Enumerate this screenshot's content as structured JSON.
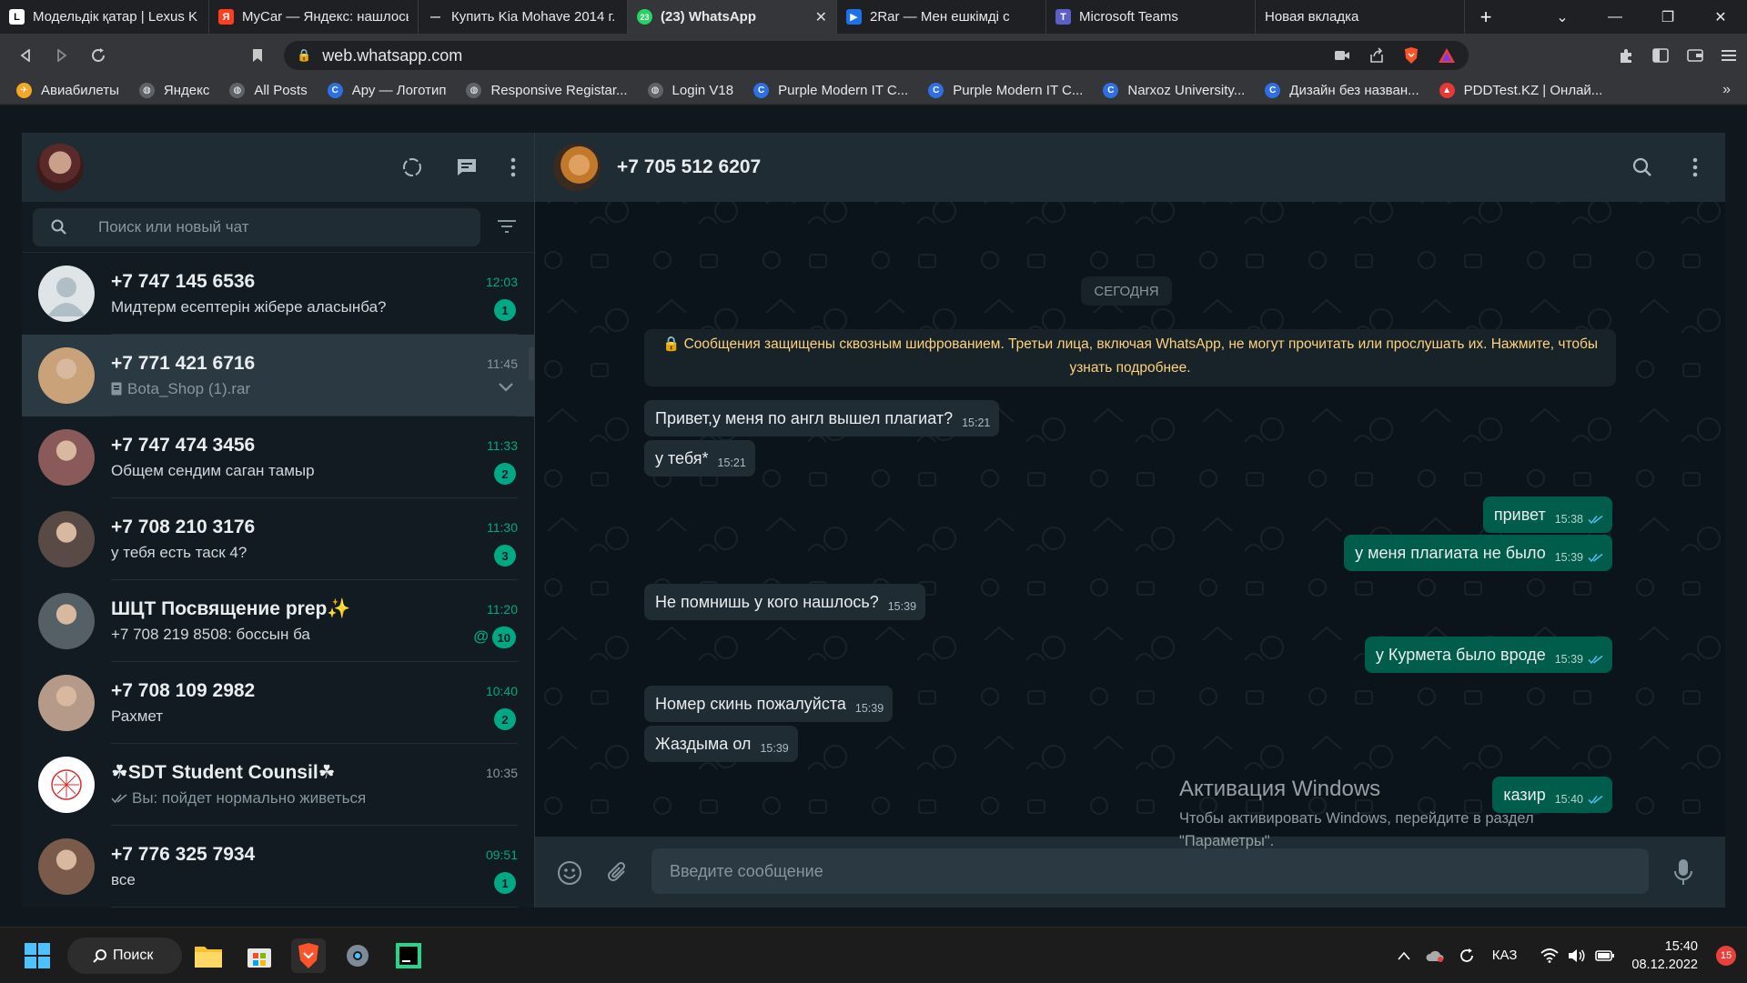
{
  "browser": {
    "tabs": [
      {
        "title": "Модельдік қатар | Lexus K",
        "icon_color": "#ffffff",
        "icon_text": "L",
        "icon_text_color": "#000000"
      },
      {
        "title": "MyCar — Яндекс: нашлось",
        "icon_color": "#fc3f1d",
        "icon_text": "Я",
        "icon_text_color": "#ffffff"
      },
      {
        "title": "Купить Kia Mohave 2014 г.",
        "icon_color": "#1f2023",
        "icon_text": "—",
        "icon_text_color": "#ffffff"
      },
      {
        "title": "(23) WhatsApp",
        "icon_color": "#25d366",
        "icon_text": "23",
        "icon_text_color": "#ffffff"
      },
      {
        "title": "2Rar — Мен ешкімді с",
        "icon_color": "#1a73e8",
        "icon_text": "▶",
        "icon_text_color": "#ffffff"
      },
      {
        "title": "Microsoft Teams",
        "icon_color": "#5b5fc7",
        "icon_text": "T",
        "icon_text_color": "#ffffff"
      },
      {
        "title": "Новая вкладка",
        "icon_color": "",
        "icon_text": "",
        "icon_text_color": ""
      }
    ],
    "url": "web.whatsapp.com",
    "bookmarks": [
      {
        "label": "Авиабилеты",
        "color": "#f5a623",
        "glyph": "✈"
      },
      {
        "label": "Яндекс",
        "color": "#5f6368",
        "glyph": "◍"
      },
      {
        "label": "All Posts",
        "color": "#5f6368",
        "glyph": "◍"
      },
      {
        "label": "Ару — Логотип",
        "color": "#2f6fe4",
        "glyph": "C"
      },
      {
        "label": "Responsive Registar...",
        "color": "#5f6368",
        "glyph": "◍"
      },
      {
        "label": "Login V18",
        "color": "#5f6368",
        "glyph": "◍"
      },
      {
        "label": "Purple Modern IT C...",
        "color": "#2f6fe4",
        "glyph": "C"
      },
      {
        "label": "Purple Modern IT C...",
        "color": "#2f6fe4",
        "glyph": "C"
      },
      {
        "label": "Narxoz University...",
        "color": "#2f6fe4",
        "glyph": "C"
      },
      {
        "label": "Дизайн без назван...",
        "color": "#2f6fe4",
        "glyph": "C"
      },
      {
        "label": "PDDTest.KZ | Онлай...",
        "color": "#e53935",
        "glyph": "▲"
      }
    ],
    "more": "»"
  },
  "sidebar": {
    "search_placeholder": "Поиск или новый чат",
    "chats": [
      {
        "name": "+7 747 145 6536",
        "message": "Мидтерм есептерін жібере аласынба?",
        "time": "12:03",
        "unread": "1",
        "time_green": true,
        "avatar": "#6b7b86",
        "default_avatar": true
      },
      {
        "name": "+7 771 421 6716",
        "message": "Bota_Shop (1).rar",
        "time": "11:45",
        "unread": "",
        "time_green": false,
        "avatar": "#c9a27a",
        "selected": true,
        "doc": true
      },
      {
        "name": "+7 747 474 3456",
        "message": "Общем сендим саган тамыр",
        "time": "11:33",
        "unread": "2",
        "time_green": true,
        "avatar": "#8a5a5a"
      },
      {
        "name": "+7 708 210 3176",
        "message": "у тебя есть таск 4?",
        "time": "11:30",
        "unread": "3",
        "time_green": true,
        "avatar": "#5a4a45"
      },
      {
        "name": "ШЦТ Посвящение prep✨",
        "message": "+7 708 219 8508: боссын ба",
        "time": "11:20",
        "unread": "10",
        "time_green": true,
        "avatar": "#556066",
        "mention": "@"
      },
      {
        "name": "+7 708 109 2982",
        "message": "Рахмет",
        "time": "10:40",
        "unread": "2",
        "time_green": true,
        "avatar": "#b59a8a"
      },
      {
        "name": "☘SDT Student Counsil☘",
        "message": "Вы: пойдет нормально живеться",
        "time": "10:35",
        "unread": "",
        "time_green": false,
        "avatar": "#ffffff",
        "ticks": true,
        "sdt": "SDT"
      },
      {
        "name": "+7 776 325 7934",
        "message": "все",
        "time": "09:51",
        "unread": "1",
        "time_green": true,
        "avatar": "#7a5a4a"
      }
    ]
  },
  "conversation": {
    "title": "+7 705 512 6207",
    "date_chip": "СЕГОДНЯ",
    "encryption_notice": "🔒 Сообщения защищены сквозным шифрованием. Третьи лица, включая WhatsApp, не могут прочитать или прослушать их. Нажмите, чтобы узнать подробнее.",
    "messages": [
      {
        "text": "Привет,у меня по англ вышел плагиат?",
        "time": "15:21",
        "dir": "in"
      },
      {
        "text": "у тебя*",
        "time": "15:21",
        "dir": "in"
      },
      {
        "text": "привет",
        "time": "15:38",
        "dir": "out"
      },
      {
        "text": "у меня плагиата не было",
        "time": "15:39",
        "dir": "out"
      },
      {
        "text": "Не помнишь у кого нашлось?",
        "time": "15:39",
        "dir": "in"
      },
      {
        "text": "у Курмета было вроде",
        "time": "15:39",
        "dir": "out"
      },
      {
        "text": "Номер скинь пожалуйста",
        "time": "15:39",
        "dir": "in"
      },
      {
        "text": "Жаздыма ол",
        "time": "15:39",
        "dir": "in"
      },
      {
        "text": "казир",
        "time": "15:40",
        "dir": "out"
      }
    ],
    "input_placeholder": "Введите сообщение"
  },
  "watermark": {
    "title": "Активация Windows",
    "text": "Чтобы активировать Windows, перейдите в раздел \"Параметры\"."
  },
  "taskbar": {
    "search_label": "Поиск",
    "lang": "КАЗ",
    "time": "15:40",
    "date": "08.12.2022",
    "notifications": "15"
  },
  "colors": {
    "accent": "#00a884",
    "outgoing_bubble": "#005c4b",
    "incoming_bubble": "#202c33",
    "panel": "#202c33",
    "background": "#0b141a"
  }
}
